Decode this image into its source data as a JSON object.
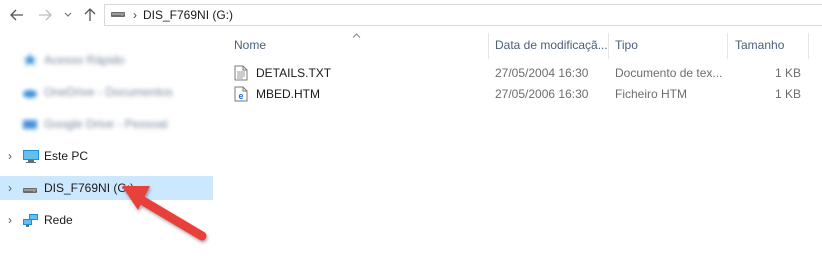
{
  "address": {
    "drive_icon": "usb-drive-icon",
    "path_label": "DIS_F769NI (G:)"
  },
  "sidebar": {
    "items": [
      {
        "label": "Acesso Rápido",
        "blurred": true
      },
      {
        "label": "OneDrive - Documentos",
        "blurred": true
      },
      {
        "label": "Google Drive - Pessoal",
        "blurred": true
      },
      {
        "label": "Este PC",
        "icon": "computer-icon"
      },
      {
        "label": "DIS_F769NI (G:)",
        "icon": "usb-drive-icon",
        "selected": true
      },
      {
        "label": "Rede",
        "icon": "network-icon"
      }
    ]
  },
  "filelist": {
    "columns": {
      "name": "Nome",
      "date": "Data de modificaçã...",
      "type": "Tipo",
      "size": "Tamanho"
    },
    "files": [
      {
        "name": "DETAILS.TXT",
        "date": "27/05/2004 16:30",
        "type": "Documento de tex...",
        "size": "1 KB",
        "icon": "text-file-icon"
      },
      {
        "name": "MBED.HTM",
        "date": "27/05/2006 16:30",
        "type": "Ficheiro HTM",
        "size": "1 KB",
        "icon": "edge-html-file-icon"
      }
    ]
  },
  "colors": {
    "selected_bg": "#cce8ff",
    "arrow": "#e8413b",
    "header_text": "#4c607a"
  }
}
